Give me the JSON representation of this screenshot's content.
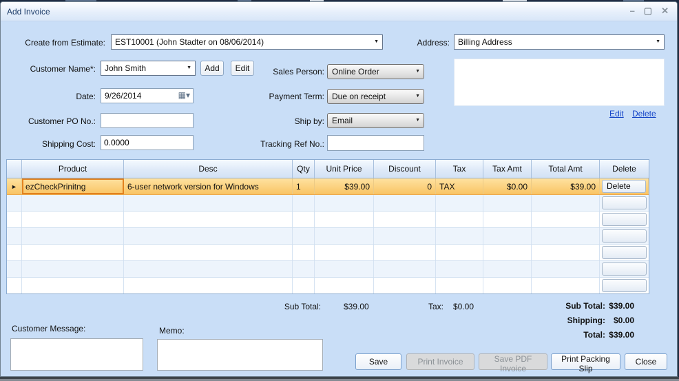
{
  "window": {
    "title": "Add Invoice"
  },
  "icons": {
    "minimize": "–",
    "maximize": "▢",
    "close": "✕",
    "dropdown": "▼",
    "calendar": "▦▾",
    "row_arrow": "►"
  },
  "form": {
    "create_from_estimate": {
      "label": "Create from Estimate:",
      "value": "EST10001 (John Stadter on 08/06/2014)"
    },
    "address": {
      "label": "Address:",
      "value": "Billing Address",
      "edit_link": "Edit",
      "delete_link": "Delete"
    },
    "customer_name": {
      "label": "Customer Name*:",
      "value": "John Smith",
      "add_button": "Add",
      "edit_button": "Edit"
    },
    "sales_person": {
      "label": "Sales Person:",
      "value": "Online Order"
    },
    "date": {
      "label": "Date:",
      "value": "9/26/2014"
    },
    "payment_term": {
      "label": "Payment Term:",
      "value": "Due on receipt"
    },
    "customer_po": {
      "label": "Customer PO No.:",
      "value": ""
    },
    "ship_by": {
      "label": "Ship by:",
      "value": "Email"
    },
    "shipping_cost": {
      "label": "Shipping Cost:",
      "value": "0.0000"
    },
    "tracking_ref": {
      "label": "Tracking Ref No.:",
      "value": ""
    }
  },
  "grid": {
    "columns": [
      "Product",
      "Desc",
      "Qty",
      "Unit Price",
      "Discount",
      "Tax",
      "Tax Amt",
      "Total Amt",
      "Delete"
    ],
    "rows": [
      {
        "product": "ezCheckPrinitng",
        "desc": "6-user network version for Windows",
        "qty": "1",
        "unit_price": "$39.00",
        "discount": "0",
        "tax": "TAX",
        "tax_amt": "$0.00",
        "total_amt": "$39.00",
        "delete_button": "Delete"
      }
    ],
    "empty_rows": 6
  },
  "totals": {
    "center": {
      "sub_total_label": "Sub Total:",
      "sub_total_value": "$39.00",
      "tax_label": "Tax:",
      "tax_value": "$0.00"
    },
    "right": [
      {
        "label": "Sub Total:",
        "value": "$39.00"
      },
      {
        "label": "Shipping:",
        "value": "$0.00"
      },
      {
        "label": "Total:",
        "value": "$39.00"
      }
    ]
  },
  "footer": {
    "customer_message_label": "Customer Message:",
    "memo_label": "Memo:",
    "buttons": [
      {
        "label": "Save",
        "enabled": true
      },
      {
        "label": "Print Invoice",
        "enabled": false
      },
      {
        "label": "Save PDF Invoice",
        "enabled": false
      },
      {
        "label": "Print Packing Slip",
        "enabled": true
      },
      {
        "label": "Close",
        "enabled": true
      }
    ]
  },
  "colors": {
    "dialog_bg": "#c9def7",
    "selected_row": "#fbce72",
    "selected_cell_border": "#e2821f",
    "link": "#1646c8",
    "grid_header_bg": "#dce9f8",
    "disabled_button_bg": "#d9dadb"
  }
}
